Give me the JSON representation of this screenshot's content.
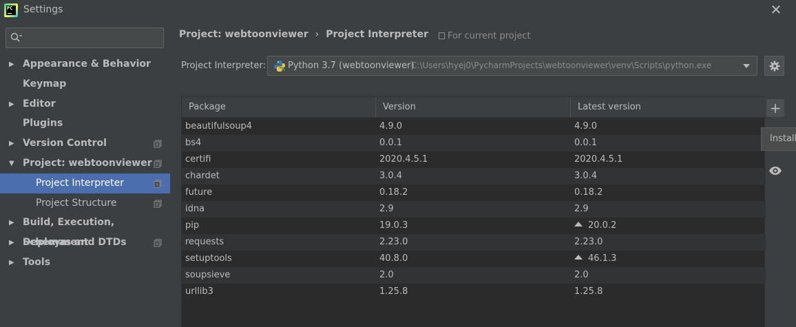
{
  "window": {
    "title": "Settings",
    "close_glyph": "✕"
  },
  "search": {
    "placeholder": "",
    "icon": "search-icon"
  },
  "sidebar": {
    "items": [
      {
        "label": "Appearance & Behavior",
        "expandable": true,
        "expanded": false
      },
      {
        "label": "Keymap",
        "expandable": false
      },
      {
        "label": "Editor",
        "expandable": true,
        "expanded": false
      },
      {
        "label": "Plugins",
        "expandable": false
      },
      {
        "label": "Version Control",
        "expandable": true,
        "expanded": false,
        "project_icon": true
      },
      {
        "label": "Project: webtoonviewer",
        "expandable": true,
        "expanded": true,
        "project_icon": true
      },
      {
        "label": "Project Interpreter",
        "child": true,
        "selected": true,
        "project_icon": true
      },
      {
        "label": "Project Structure",
        "child": true,
        "project_icon": true
      },
      {
        "label": "Build, Execution, Deployment",
        "expandable": true,
        "expanded": false
      },
      {
        "label": "Schemas and DTDs",
        "expandable": true,
        "expanded": false,
        "project_icon": true
      },
      {
        "label": "Tools",
        "expandable": true,
        "expanded": false
      }
    ]
  },
  "header": {
    "breadcrumb_project": "Project: webtoonviewer",
    "breadcrumb_sep": "›",
    "breadcrumb_page": "Project Interpreter",
    "scope_note": "For current project"
  },
  "interpreter": {
    "label": "Project Interpreter:",
    "name": "Python 3.7 (webtoonviewer)",
    "path": "C:\\Users\\hyej0\\PycharmProjects\\webtoonviewer\\venv\\Scripts\\python.exe"
  },
  "packages": {
    "columns": [
      "Package",
      "Version",
      "Latest version"
    ],
    "rows": [
      {
        "package": "beautifulsoup4",
        "version": "4.9.0",
        "latest": "4.9.0",
        "upgrade": false
      },
      {
        "package": "bs4",
        "version": "0.0.1",
        "latest": "0.0.1",
        "upgrade": false
      },
      {
        "package": "certifi",
        "version": "2020.4.5.1",
        "latest": "2020.4.5.1",
        "upgrade": false
      },
      {
        "package": "chardet",
        "version": "3.0.4",
        "latest": "3.0.4",
        "upgrade": false
      },
      {
        "package": "future",
        "version": "0.18.2",
        "latest": "0.18.2",
        "upgrade": false
      },
      {
        "package": "idna",
        "version": "2.9",
        "latest": "2.9",
        "upgrade": false
      },
      {
        "package": "pip",
        "version": "19.0.3",
        "latest": "20.0.2",
        "upgrade": true
      },
      {
        "package": "requests",
        "version": "2.23.0",
        "latest": "2.23.0",
        "upgrade": false
      },
      {
        "package": "setuptools",
        "version": "40.8.0",
        "latest": "46.1.3",
        "upgrade": true
      },
      {
        "package": "soupsieve",
        "version": "2.0",
        "latest": "2.0",
        "upgrade": false
      },
      {
        "package": "urllib3",
        "version": "1.25.8",
        "latest": "1.25.8",
        "upgrade": false
      }
    ]
  },
  "toolbar": {
    "add_glyph": "+",
    "tooltip": "Install"
  },
  "colors": {
    "background": "#3c3f41",
    "selection": "#4b6eaf",
    "table_bg": "#2b2b2b",
    "text": "#bbbbbb"
  }
}
